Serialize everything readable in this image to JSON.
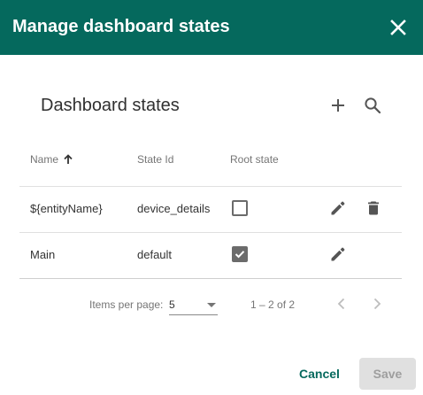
{
  "dialog": {
    "title": "Manage dashboard states",
    "close_icon": "close-icon"
  },
  "colors": {
    "header_bg": "#05695d",
    "accent": "#05695d",
    "save_disabled_bg": "#e0e0e0"
  },
  "section": {
    "title": "Dashboard states",
    "add_icon": "plus-icon",
    "search_icon": "search-icon"
  },
  "table": {
    "columns": {
      "name": "Name",
      "state_id": "State Id",
      "root_state": "Root state"
    },
    "sort": {
      "column": "name",
      "direction": "ascending",
      "icon": "arrow-up-icon"
    },
    "rows": [
      {
        "name": "${entityName}",
        "state_id": "device_details",
        "root_state": false,
        "actions": [
          "edit",
          "delete"
        ]
      },
      {
        "name": "Main",
        "state_id": "default",
        "root_state": true,
        "actions": [
          "edit"
        ]
      }
    ]
  },
  "paginator": {
    "items_per_page_label": "Items per page:",
    "page_size": "5",
    "range_label": "1 – 2 of 2",
    "prev_icon": "chevron-left-icon",
    "next_icon": "chevron-right-icon"
  },
  "actions": {
    "cancel_label": "Cancel",
    "save_label": "Save"
  }
}
